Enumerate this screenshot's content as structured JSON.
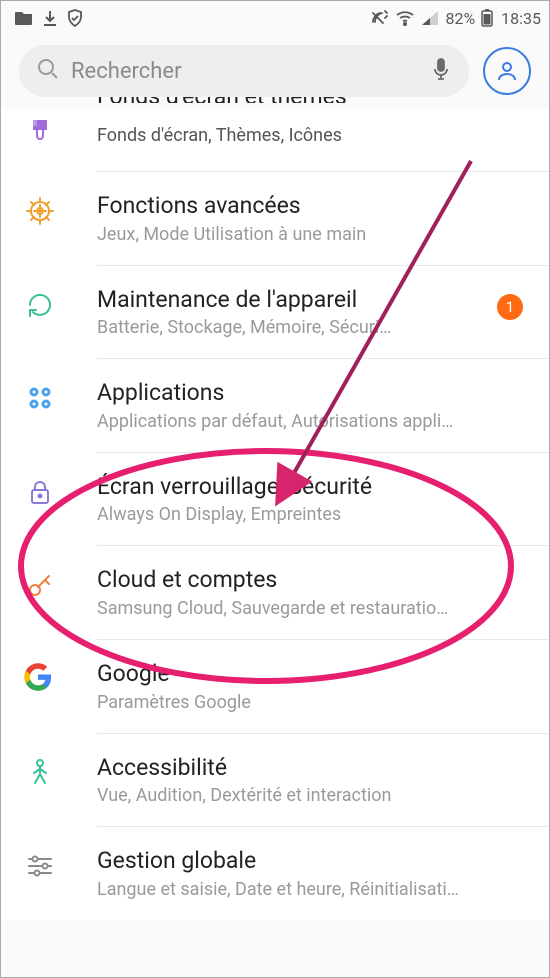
{
  "status": {
    "battery_pct": "82%",
    "time": "18:35"
  },
  "search": {
    "placeholder": "Rechercher"
  },
  "items": [
    {
      "id": "wallpaper",
      "title": "Fonds d'écran et thèmes",
      "sub": "Fonds d'écran, Thèmes, Icônes",
      "icon": "brush",
      "color": "#a06bd6",
      "cut": true
    },
    {
      "id": "advanced",
      "title": "Fonctions avancées",
      "sub": "Jeux, Mode Utilisation à une main",
      "icon": "gear",
      "color": "#f0a030"
    },
    {
      "id": "maintenance",
      "title": "Maintenance de l'appareil",
      "sub": "Batterie, Stockage, Mémoire, Sécuri…",
      "icon": "refresh",
      "color": "#3cc08c",
      "badge": "1"
    },
    {
      "id": "apps",
      "title": "Applications",
      "sub": "Applications par défaut, Autorisations appli…",
      "icon": "grid",
      "color": "#4aa3ef"
    },
    {
      "id": "lockscreen",
      "title": "Écran verrouillage/Sécurité",
      "sub": "Always On Display, Empreintes",
      "icon": "lock",
      "color": "#8d7bd9"
    },
    {
      "id": "cloud",
      "title": "Cloud et comptes",
      "sub": "Samsung Cloud, Sauvegarde et restauratio…",
      "icon": "key",
      "color": "#f08040"
    },
    {
      "id": "google",
      "title": "Google",
      "sub": "Paramètres Google",
      "icon": "google",
      "color": "#4285F4"
    },
    {
      "id": "a11y",
      "title": "Accessibilité",
      "sub": "Vue, Audition, Dextérité et interaction",
      "icon": "person",
      "color": "#34c29a"
    },
    {
      "id": "general",
      "title": "Gestion globale",
      "sub": "Langue et saisie, Date et heure, Réinitialisati…",
      "icon": "sliders",
      "color": "#8a8a8a"
    }
  ]
}
